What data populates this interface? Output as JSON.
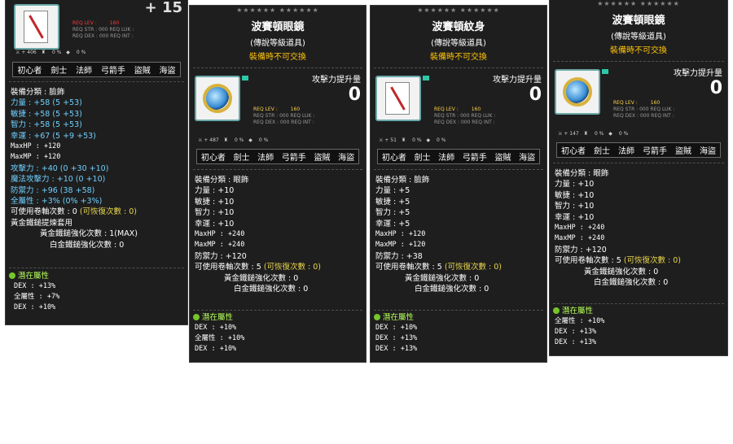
{
  "panels": [
    {
      "top_fragment": "+ 15",
      "req_lev_label": "REQ LEV :",
      "req_lev": "160",
      "req_rows": [
        "REQ STR : 000   REQ LUK :",
        "REQ DEX : 000   REQ INT :"
      ],
      "mini": [
        "+ 406",
        "0 %",
        "0 %"
      ],
      "jobs": [
        "初心者",
        "劍士",
        "法師",
        "弓箭手",
        "盜賊",
        "海盜"
      ],
      "stats": [
        {
          "t": "裝備分類 : 臉飾"
        },
        {
          "t": "力量 : +58 (5 +53)",
          "c": "blue"
        },
        {
          "t": "敏捷 : +58 (5 +53)",
          "c": "blue"
        },
        {
          "t": "智力 : +58 (5 +53)",
          "c": "blue"
        },
        {
          "t": "幸運 : +67 (5 +9 +53)",
          "c": "blue"
        },
        {
          "t": "MaxHP : +120",
          "m": true
        },
        {
          "t": "MaxMP : +120",
          "m": true
        },
        {
          "t": "攻擊力 : +40 (0 +30 +10)",
          "c": "blue"
        },
        {
          "t": "魔法攻擊力 : +10 (0 +10)",
          "c": "blue"
        },
        {
          "t": "防禦力 : +96 (38 +58)",
          "c": "blue"
        },
        {
          "t": "全屬性 : +3% (0% +3%)",
          "c": "blue"
        },
        {
          "t": "可使用卷軸次數 : 0 (可恢復次數 : 0)"
        },
        {
          "t": "黃金鐵鎚提煉套用"
        },
        {
          "t": "黃金鐵鎚強化次數 : 1(MAX)",
          "i": 1
        },
        {
          "t": "白金鐵鎚強化次數 : 0",
          "i": 2
        }
      ],
      "potential_title": "潛在屬性",
      "potential": [
        "DEX : +13%",
        "全屬性 : +7%",
        "DEX : +10%"
      ]
    },
    {
      "stars": "★★★★★★ ★★★★★★",
      "name": "波賽頓眼鏡",
      "grade": "(傳說等級道具)",
      "trade": "裝備時不可交換",
      "atk_label": "攻擊力提升量",
      "atk_value": "0",
      "req_lev_label": "REQ LEV :",
      "req_lev": "160",
      "req_rows": [
        "REQ STR : 000   REQ LUK :",
        "REQ DEX : 000   REQ INT :"
      ],
      "mini": [
        "+ 487",
        "0 %",
        "0 %"
      ],
      "jobs": [
        "初心者",
        "劍士",
        "法師",
        "弓箭手",
        "盜賊",
        "海盜"
      ],
      "stats": [
        {
          "t": "裝備分類 : 眼飾"
        },
        {
          "t": "力量 : +10"
        },
        {
          "t": "敏捷 : +10"
        },
        {
          "t": "智力 : +10"
        },
        {
          "t": "幸運 : +10"
        },
        {
          "t": "MaxHP : +240",
          "m": true
        },
        {
          "t": "MaxMP : +240",
          "m": true
        },
        {
          "t": "防禦力 : +120"
        },
        {
          "t": "可使用卷軸次數 : 5 (可恢復次數 : 0)"
        },
        {
          "t": "黃金鐵鎚強化次數 : 0",
          "i": 1
        },
        {
          "t": "白金鐵鎚強化次數 : 0",
          "i": 2
        }
      ],
      "potential_title": "潛在屬性",
      "potential": [
        "DEX : +10%",
        "全屬性 : +10%",
        "DEX : +10%"
      ]
    },
    {
      "stars": "★★★★★★ ★★★★★★",
      "name": "波賽頓紋身",
      "grade": "(傳說等級道具)",
      "trade": "裝備時不可交換",
      "atk_label": "攻擊力提升量",
      "atk_value": "0",
      "req_lev_label": "REQ LEV :",
      "req_lev": "160",
      "req_rows": [
        "REQ STR : 000   REQ LUK :",
        "REQ DEX : 000   REQ INT :"
      ],
      "mini": [
        "+ 51",
        "0 %",
        "0 %"
      ],
      "jobs": [
        "初心者",
        "劍士",
        "法師",
        "弓箭手",
        "盜賊",
        "海盜"
      ],
      "stats": [
        {
          "t": "裝備分類 : 臉飾"
        },
        {
          "t": "力量 : +5"
        },
        {
          "t": "敏捷 : +5"
        },
        {
          "t": "智力 : +5"
        },
        {
          "t": "幸運 : +5"
        },
        {
          "t": "MaxHP : +120",
          "m": true
        },
        {
          "t": "MaxMP : +120",
          "m": true
        },
        {
          "t": "防禦力 : +38"
        },
        {
          "t": "可使用卷軸次數 : 5 (可恢復次數 : 0)"
        },
        {
          "t": "黃金鐵鎚強化次數 : 0",
          "i": 1
        },
        {
          "t": "白金鐵鎚強化次數 : 0",
          "i": 2
        }
      ],
      "potential_title": "潛在屬性",
      "potential": [
        "DEX : +10%",
        "DEX : +13%",
        "DEX : +13%"
      ]
    },
    {
      "stars": "★★★★★★ ★★★★★★",
      "name": "波賽頓眼鏡",
      "grade": "(傳說等級道具)",
      "trade": "裝備時不可交換",
      "atk_label": "攻擊力提升量",
      "atk_value": "0",
      "req_lev_label": "REQ LEV :",
      "req_lev": "160",
      "req_rows": [
        "REQ STR : 000   REQ LUK :",
        "REQ DEX : 000   REQ INT :"
      ],
      "mini": [
        "+ 147",
        "0 %",
        "0 %"
      ],
      "jobs": [
        "初心者",
        "劍士",
        "法師",
        "弓箭手",
        "盜賊",
        "海盜"
      ],
      "stats": [
        {
          "t": "裝備分類 : 眼飾"
        },
        {
          "t": "力量 : +10"
        },
        {
          "t": "敏捷 : +10"
        },
        {
          "t": "智力 : +10"
        },
        {
          "t": "幸運 : +10"
        },
        {
          "t": "MaxHP : +240",
          "m": true
        },
        {
          "t": "MaxMP : +240",
          "m": true
        },
        {
          "t": "防禦力 : +120"
        },
        {
          "t": "可使用卷軸次數 : 5 (可恢復次數 : 0)"
        },
        {
          "t": "黃金鐵鎚強化次數 : 0",
          "i": 1
        },
        {
          "t": "白金鐵鎚強化次數 : 0",
          "i": 2
        }
      ],
      "potential_title": "潛在屬性",
      "potential": [
        "全屬性 : +10%",
        "DEX : +13%",
        "DEX : +13%"
      ]
    }
  ]
}
